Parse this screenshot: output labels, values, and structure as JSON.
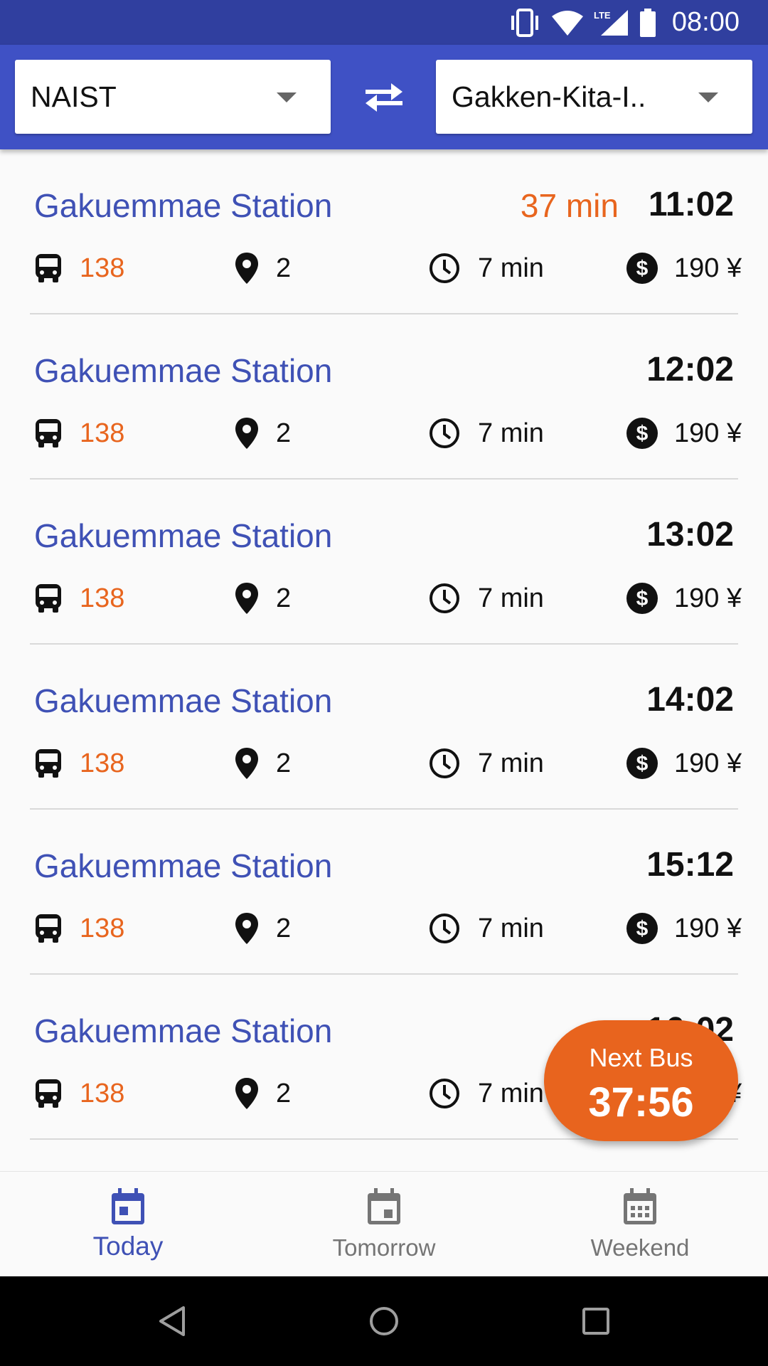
{
  "status_bar": {
    "time": "08:00",
    "network": "LTE"
  },
  "toolbar": {
    "from": "NAIST",
    "to": "Gakken-Kita-I..",
    "colors": {
      "primary": "#3f51c5",
      "primary_dark": "#303f9f",
      "accent": "#e8651e"
    }
  },
  "departures": [
    {
      "destination": "Gakuemmae Station",
      "countdown": "37 min",
      "time": "11:02",
      "route": "138",
      "stop": "2",
      "duration": "7 min",
      "fare": "190 ¥"
    },
    {
      "destination": "Gakuemmae Station",
      "countdown": "",
      "time": "12:02",
      "route": "138",
      "stop": "2",
      "duration": "7 min",
      "fare": "190 ¥"
    },
    {
      "destination": "Gakuemmae Station",
      "countdown": "",
      "time": "13:02",
      "route": "138",
      "stop": "2",
      "duration": "7 min",
      "fare": "190 ¥"
    },
    {
      "destination": "Gakuemmae Station",
      "countdown": "",
      "time": "14:02",
      "route": "138",
      "stop": "2",
      "duration": "7 min",
      "fare": "190 ¥"
    },
    {
      "destination": "Gakuemmae Station",
      "countdown": "",
      "time": "15:12",
      "route": "138",
      "stop": "2",
      "duration": "7 min",
      "fare": "190 ¥"
    },
    {
      "destination": "Gakuemmae Station",
      "countdown": "",
      "time": "16:02",
      "route": "138",
      "stop": "2",
      "duration": "7 min",
      "fare": "190 ¥"
    }
  ],
  "fab": {
    "label": "Next Bus",
    "value": "37:56"
  },
  "bottom_nav": {
    "items": [
      {
        "label": "Today",
        "icon": "calendar-today-icon",
        "active": true
      },
      {
        "label": "Tomorrow",
        "icon": "calendar-event-icon",
        "active": false
      },
      {
        "label": "Weekend",
        "icon": "calendar-range-icon",
        "active": false
      }
    ]
  }
}
